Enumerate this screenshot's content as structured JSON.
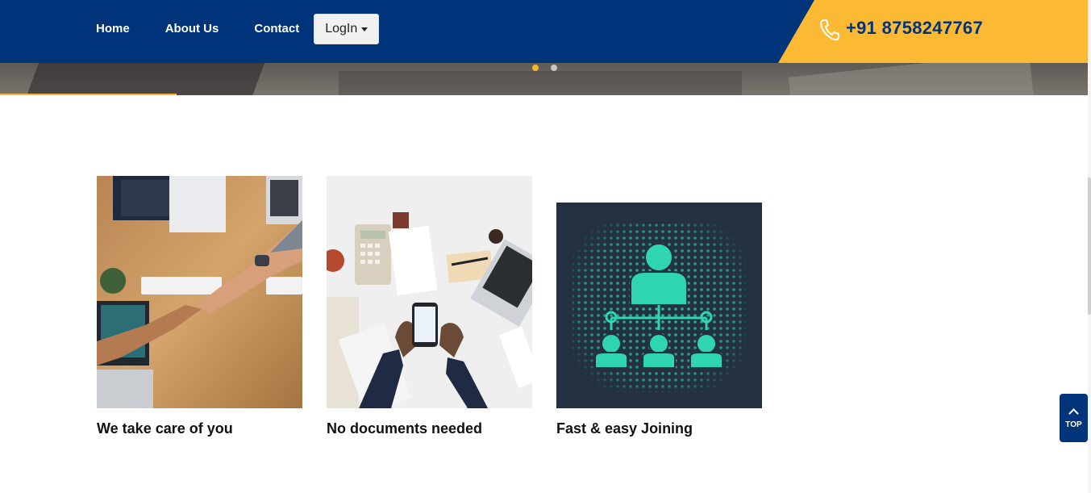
{
  "nav": {
    "home": "Home",
    "about": "About Us",
    "contact": "Contact",
    "login": "LogIn"
  },
  "phone": {
    "icon": "phone-icon",
    "number": "+91 8758247767"
  },
  "carousel": {
    "slides": 2,
    "active": 1
  },
  "features": [
    {
      "title": "We take care of you",
      "image": "handshake-photo"
    },
    {
      "title": "No documents needed",
      "image": "desk-phone-photo"
    },
    {
      "title": "Fast & easy Joining",
      "image": "network-hierarchy-graphic"
    }
  ],
  "back_to_top": {
    "label": "TOP",
    "icon": "chevron-up-icon"
  },
  "colors": {
    "primary": "#00347a",
    "accent": "#fbb934",
    "teal": "#2fd4b0"
  }
}
